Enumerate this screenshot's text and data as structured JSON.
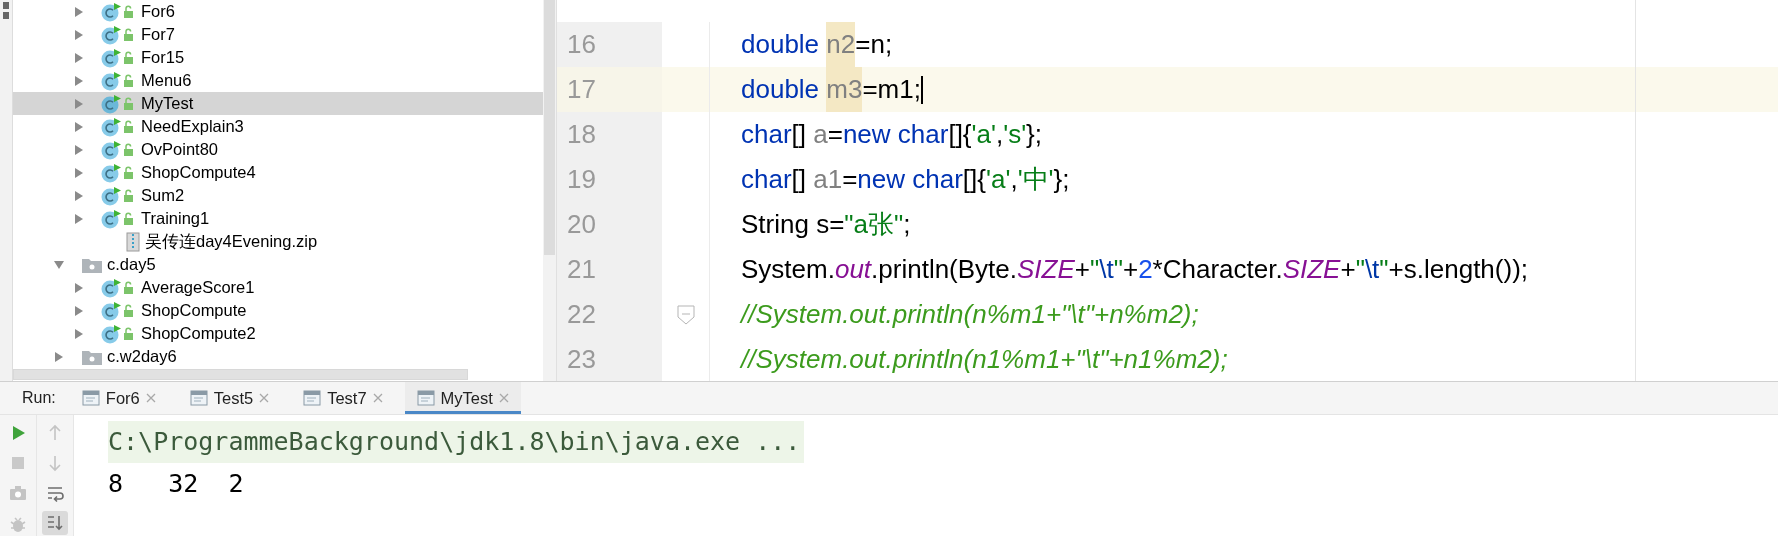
{
  "project_tree": [
    {
      "children": [
        {
          "label": "For6",
          "kind": "class",
          "expanded": false,
          "selected": false
        },
        {
          "label": "For7",
          "kind": "class",
          "expanded": false,
          "selected": false
        },
        {
          "label": "For15",
          "kind": "class",
          "expanded": false,
          "selected": false
        },
        {
          "label": "Menu6",
          "kind": "class",
          "expanded": false,
          "selected": false
        },
        {
          "label": "MyTest",
          "kind": "class",
          "expanded": false,
          "selected": true
        },
        {
          "label": "NeedExplain3",
          "kind": "class",
          "expanded": false,
          "selected": false
        },
        {
          "label": "OvPoint80",
          "kind": "class",
          "expanded": false,
          "selected": false
        },
        {
          "label": "ShopCompute4",
          "kind": "class",
          "expanded": false,
          "selected": false
        },
        {
          "label": "Sum2",
          "kind": "class",
          "expanded": false,
          "selected": false
        },
        {
          "label": "Training1",
          "kind": "class",
          "expanded": false,
          "selected": false
        },
        {
          "label": "吴传连day4Evening.zip",
          "kind": "archive",
          "selected": false
        }
      ]
    },
    {
      "label": "c.day5",
      "kind": "package",
      "expanded": true,
      "selected": false,
      "children": [
        {
          "label": "AverageScore1",
          "kind": "class",
          "expanded": false,
          "selected": false
        },
        {
          "label": "ShopCompute",
          "kind": "class",
          "expanded": false,
          "selected": false
        },
        {
          "label": "ShopCompute2",
          "kind": "class",
          "expanded": false,
          "selected": false
        }
      ]
    },
    {
      "label": "c.w2day6",
      "kind": "package",
      "expanded": false,
      "selected": false
    }
  ],
  "editor": {
    "lines": [
      {
        "number": "16",
        "current": false,
        "fold": false,
        "tokens": [
          {
            "text": "double ",
            "kind": "keyword"
          },
          {
            "text": "n2",
            "kind": "unused",
            "highlighted": true
          },
          {
            "text": "=n;",
            "kind": "plain"
          }
        ]
      },
      {
        "number": "17",
        "current": true,
        "fold": false,
        "tokens": [
          {
            "text": "double ",
            "kind": "keyword"
          },
          {
            "text": "m3",
            "kind": "unused",
            "highlighted": true
          },
          {
            "text": "=m1;",
            "kind": "plain"
          }
        ]
      },
      {
        "number": "18",
        "current": false,
        "fold": false,
        "tokens": [
          {
            "text": "char",
            "kind": "keyword"
          },
          {
            "text": "[] ",
            "kind": "plain"
          },
          {
            "text": "a",
            "kind": "unused"
          },
          {
            "text": "=",
            "kind": "plain"
          },
          {
            "text": "new char",
            "kind": "keyword"
          },
          {
            "text": "[]{",
            "kind": "plain"
          },
          {
            "text": "'a'",
            "kind": "string"
          },
          {
            "text": ",",
            "kind": "plain"
          },
          {
            "text": "'s'",
            "kind": "string"
          },
          {
            "text": "};",
            "kind": "plain"
          }
        ]
      },
      {
        "number": "19",
        "current": false,
        "fold": false,
        "tokens": [
          {
            "text": "char",
            "kind": "keyword"
          },
          {
            "text": "[] ",
            "kind": "plain"
          },
          {
            "text": "a1",
            "kind": "unused"
          },
          {
            "text": "=",
            "kind": "plain"
          },
          {
            "text": "new char",
            "kind": "keyword"
          },
          {
            "text": "[]{",
            "kind": "plain"
          },
          {
            "text": "'a'",
            "kind": "string"
          },
          {
            "text": ",",
            "kind": "plain"
          },
          {
            "text": "'中'",
            "kind": "string"
          },
          {
            "text": "};",
            "kind": "plain"
          }
        ]
      },
      {
        "number": "20",
        "current": false,
        "fold": false,
        "tokens": [
          {
            "text": "String s=",
            "kind": "plain"
          },
          {
            "text": "\"a张\"",
            "kind": "string"
          },
          {
            "text": ";",
            "kind": "plain"
          }
        ]
      },
      {
        "number": "21",
        "current": false,
        "fold": false,
        "tokens": [
          {
            "text": "System.",
            "kind": "plain"
          },
          {
            "text": "out",
            "kind": "static"
          },
          {
            "text": ".println(Byte.",
            "kind": "plain"
          },
          {
            "text": "SIZE",
            "kind": "static"
          },
          {
            "text": "+",
            "kind": "plain"
          },
          {
            "text": "\"",
            "kind": "string"
          },
          {
            "text": "\\t",
            "kind": "escape"
          },
          {
            "text": "\"",
            "kind": "string"
          },
          {
            "text": "+",
            "kind": "plain"
          },
          {
            "text": "2",
            "kind": "number"
          },
          {
            "text": "*Character.",
            "kind": "plain"
          },
          {
            "text": "SIZE",
            "kind": "static"
          },
          {
            "text": "+",
            "kind": "plain"
          },
          {
            "text": "\"",
            "kind": "string"
          },
          {
            "text": "\\t",
            "kind": "escape"
          },
          {
            "text": "\"",
            "kind": "string"
          },
          {
            "text": "+s.length());",
            "kind": "plain"
          }
        ]
      },
      {
        "number": "22",
        "current": false,
        "fold": true,
        "tokens": [
          {
            "text": "//System.out.println(n%m1+\"\\t\"+n%m2);",
            "kind": "comment"
          }
        ]
      },
      {
        "number": "23",
        "current": false,
        "fold": false,
        "tokens": [
          {
            "text": "//System.out.println(n1%m1+\"\\t\"+n1%m2);",
            "kind": "comment"
          }
        ]
      }
    ]
  },
  "run_panel": {
    "label": "Run:",
    "tabs": [
      {
        "label": "For6",
        "selected": false
      },
      {
        "label": "Test5",
        "selected": false
      },
      {
        "label": "Test7",
        "selected": false
      },
      {
        "label": "MyTest",
        "selected": true
      }
    ],
    "toolbar_left": [
      {
        "kind": "run"
      },
      {
        "kind": "stop"
      },
      {
        "kind": "camera"
      },
      {
        "kind": "bug"
      }
    ],
    "toolbar_right": [
      {
        "kind": "up",
        "on": false
      },
      {
        "kind": "down",
        "on": false
      },
      {
        "kind": "wrap",
        "on": false
      },
      {
        "kind": "scroll-end",
        "on": true
      }
    ],
    "output": [
      {
        "text": "C:\\ProgrammeBackground\\jdk1.8\\bin\\java.exe ...",
        "kind": "command"
      },
      {
        "text": "8\t32\t2",
        "kind": "plain"
      }
    ]
  }
}
